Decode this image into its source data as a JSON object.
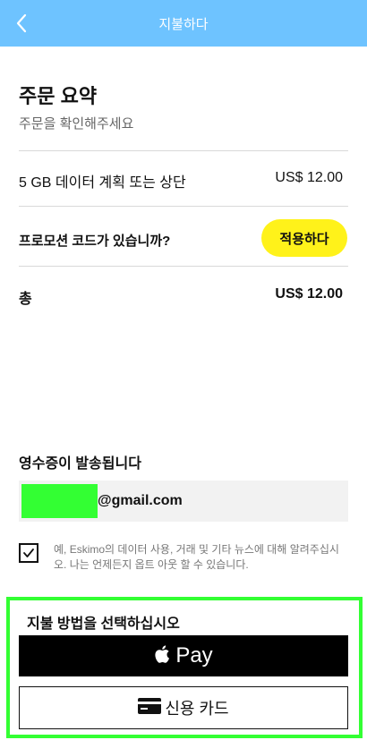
{
  "header": {
    "title": "지불하다"
  },
  "summary": {
    "title": "주문 요약",
    "subtitle": "주문을 확인해주세요"
  },
  "item": {
    "label": "5 GB 데이터 계획 또는 상단",
    "price": "US$ 12.00"
  },
  "promo": {
    "label": "프로모션 코드가 있습니까?",
    "button": "적용하다"
  },
  "total": {
    "label": "총",
    "value": "US$ 12.00"
  },
  "receipt": {
    "title": "영수증이 발송됩니다",
    "email": "@gmail.com"
  },
  "consent": {
    "checked": true,
    "text": "예, Eskimo의 데이터 사용, 거래 및 기타 뉴스에 대해 알려주십시오. 나는 언제든지 옵트 아웃 할 수 있습니다."
  },
  "payment": {
    "title": "지불 방법을 선택하십시오",
    "apple_pay": "Pay",
    "card": "신용 카드"
  },
  "colors": {
    "header_bg": "#6ec3ff",
    "apply_bg": "#fff21a",
    "highlight": "#33ff33"
  }
}
